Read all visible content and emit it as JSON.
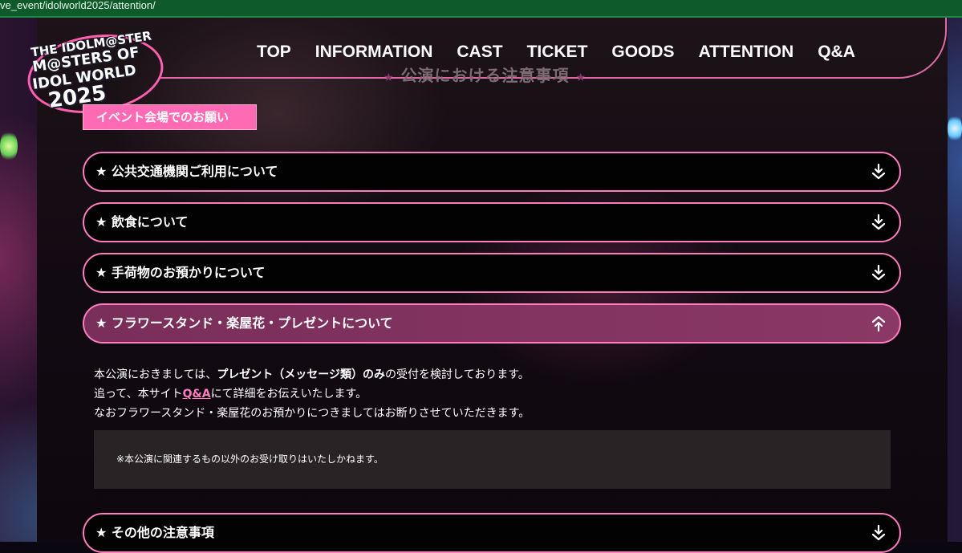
{
  "browser": {
    "url": "ve_event/idolworld2025/attention/"
  },
  "logo": {
    "line1": "THE IDOLM@STER",
    "line2": "M@STERS OF",
    "line3": "IDOL WORLD",
    "line4": "2025"
  },
  "nav": {
    "items": [
      "TOP",
      "INFORMATION",
      "CAST",
      "TICKET",
      "GOODS",
      "ATTENTION",
      "Q&A"
    ]
  },
  "page_heading": "公演における注意事項",
  "section_tag": "イベント会場でのお願い",
  "accordion": [
    {
      "title": "★ 公共交通機関ご利用について",
      "state": "collapsed"
    },
    {
      "title": "★ 飲食について",
      "state": "collapsed"
    },
    {
      "title": "★ 手荷物のお預かりについて",
      "state": "collapsed"
    },
    {
      "title": "★ フラワースタンド・楽屋花・プレゼントについて",
      "state": "expanded"
    },
    {
      "title": "★ その他の注意事項",
      "state": "collapsed"
    }
  ],
  "open_body": {
    "line1_a": "本公演におきましては、",
    "line1_b": "プレゼント（メッセージ類）のみ",
    "line1_c": "の受付を検討しております。",
    "line2_a": "追って、本サイト",
    "line2_link": "Q&A",
    "line2_b": "にて詳細をお伝えいたします。",
    "line3": "なおフラワースタンド・楽屋花のお預かりにつきましてはお断りさせていただきます。",
    "note": "※本公演に関連するもの以外のお受け取りはいたしかねます。"
  },
  "colors": {
    "accent_pink": "#ff7cbf",
    "tag_pink": "#ff6ab4",
    "open_row": "#8a3865"
  }
}
